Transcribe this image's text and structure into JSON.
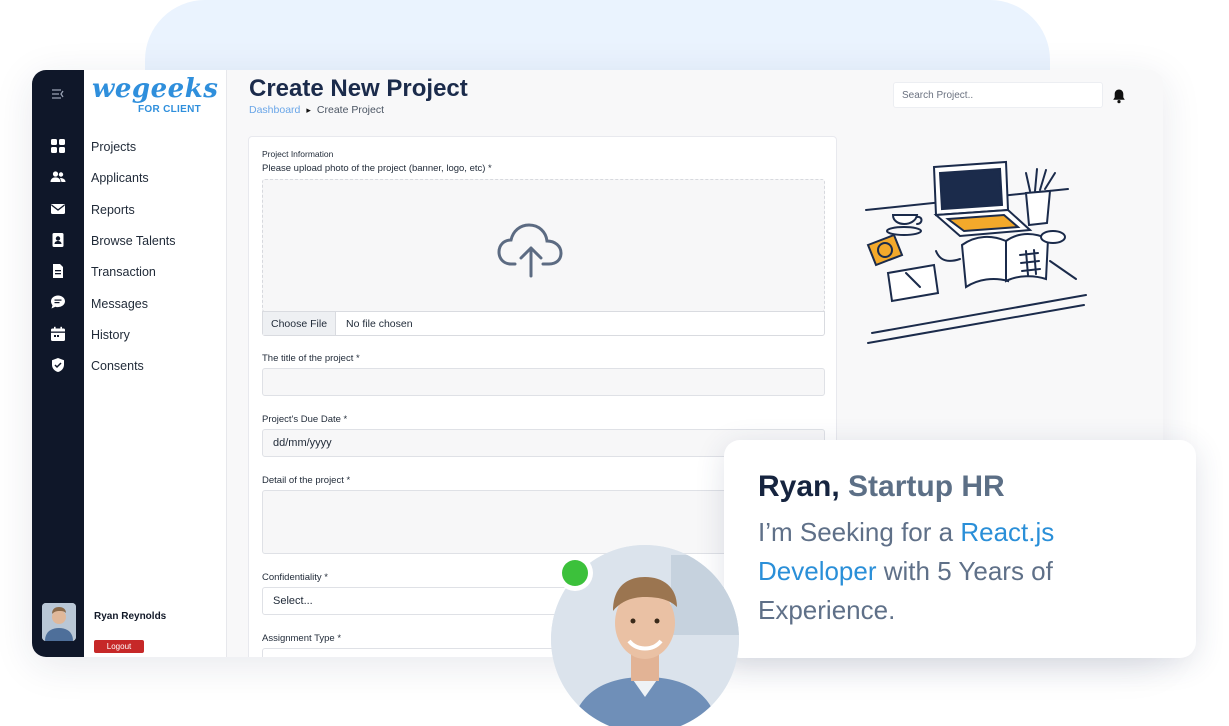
{
  "app": {
    "brand_main": "wegeeks",
    "brand_sub": "FOR CLIENT",
    "accent_color": "#2f8fdc"
  },
  "rail": {
    "icons": [
      "menu-collapse-icon",
      "grid-icon",
      "users-icon",
      "envelope-icon",
      "contact-card-icon",
      "document-icon",
      "chat-bubble-icon",
      "calendar-icon",
      "shield-check-icon"
    ]
  },
  "sidebar": {
    "items": [
      {
        "label": "Projects",
        "icon": "grid-icon"
      },
      {
        "label": "Applicants",
        "icon": "users-icon"
      },
      {
        "label": "Reports",
        "icon": "envelope-icon"
      },
      {
        "label": "Browse Talents",
        "icon": "contact-card-icon"
      },
      {
        "label": "Transaction",
        "icon": "document-icon"
      },
      {
        "label": "Messages",
        "icon": "chat-bubble-icon"
      },
      {
        "label": "History",
        "icon": "calendar-icon"
      },
      {
        "label": "Consents",
        "icon": "shield-check-icon"
      }
    ],
    "user_name": "Ryan Reynolds",
    "logout_label": "Logout"
  },
  "header": {
    "title": "Create New Project",
    "breadcrumb_link": "Dashboard",
    "breadcrumb_current": "Create Project",
    "search_placeholder": "Search Project..",
    "bell_icon": "bell-icon"
  },
  "form": {
    "section_label": "Project Information",
    "upload_label": "Please upload photo of the project (banner, logo, etc) *",
    "choose_file_label": "Choose File",
    "file_status": "No file chosen",
    "title_label": "The title of the project *",
    "title_value": "",
    "due_date_label": "Project's Due Date *",
    "due_date_placeholder": "dd/mm/yyyy",
    "detail_label": "Detail of the project *",
    "confidentiality_label": "Confidentiality *",
    "confidentiality_value": "Select...",
    "assignment_label": "Assignment Type *"
  },
  "testimonial": {
    "name": "Ryan,",
    "role": "Startup HR",
    "quote_prefix": "I’m Seeking for a",
    "quote_highlight": "React.js Developer",
    "quote_suffix": "with 5 Years of Experience.",
    "status_color": "#3cc13b"
  }
}
